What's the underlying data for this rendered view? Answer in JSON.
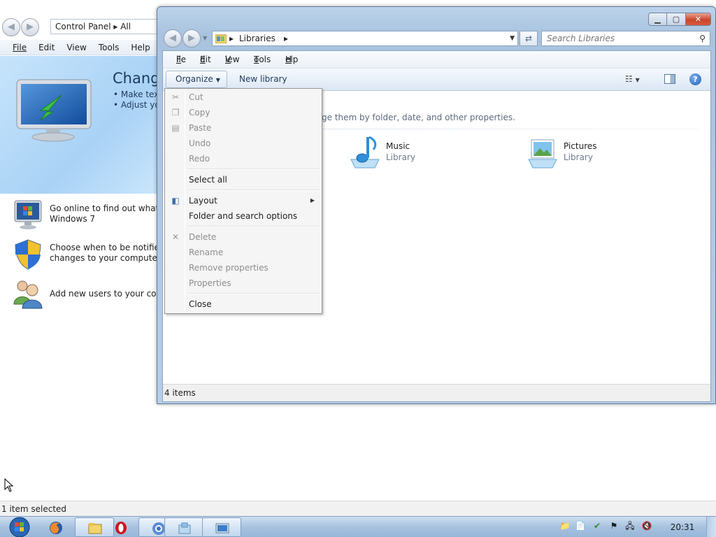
{
  "background_window": {
    "address": "Control Panel  ▸  All",
    "menu": [
      "File",
      "Edit",
      "View",
      "Tools",
      "Help"
    ],
    "banner_title": "Change",
    "banner_bullets": [
      "• Make text",
      "• Adjust you"
    ],
    "tasks": [
      {
        "line1": "Go online to find out what's n",
        "line2": "Windows 7",
        "icon": "windows-monitor-icon"
      },
      {
        "line1": "Choose when to be notified a",
        "line2": "changes to your computer",
        "icon": "uac-shield-icon"
      },
      {
        "line1": "Add new users to your comp",
        "line2": "",
        "icon": "users-icon"
      }
    ],
    "status": "1 item selected"
  },
  "window": {
    "address_crumb": "Libraries",
    "search_placeholder": "Search Libraries",
    "menu": [
      {
        "label": "File",
        "key": "F"
      },
      {
        "label": "Edit",
        "key": "E"
      },
      {
        "label": "View",
        "key": "V"
      },
      {
        "label": "Tools",
        "key": "T"
      },
      {
        "label": "Help",
        "key": "H"
      }
    ],
    "toolbar": {
      "organize": "Organize",
      "new_library": "New library"
    },
    "description": "ge them by folder, date, and other properties.",
    "libraries": [
      {
        "name": "Music",
        "sub": "Library",
        "icon": "music-library-icon"
      },
      {
        "name": "Pictures",
        "sub": "Library",
        "icon": "pictures-library-icon"
      }
    ],
    "status": "4 items"
  },
  "organize_menu": {
    "items": [
      {
        "label": "Cut",
        "enabled": false,
        "icon": "cut-icon"
      },
      {
        "label": "Copy",
        "enabled": false,
        "icon": "copy-icon"
      },
      {
        "label": "Paste",
        "enabled": false,
        "icon": "paste-icon"
      },
      {
        "label": "Undo",
        "enabled": false
      },
      {
        "label": "Redo",
        "enabled": false
      },
      {
        "label": "Select all",
        "enabled": true
      },
      {
        "label": "Layout",
        "enabled": true,
        "icon": "layout-icon",
        "submenu": true
      },
      {
        "label": "Folder and search options",
        "enabled": true
      },
      {
        "label": "Delete",
        "enabled": false,
        "icon": "delete-icon"
      },
      {
        "label": "Rename",
        "enabled": false
      },
      {
        "label": "Remove properties",
        "enabled": false
      },
      {
        "label": "Properties",
        "enabled": false
      },
      {
        "label": "Close",
        "enabled": true
      }
    ]
  },
  "taskbar": {
    "clock": "20:31",
    "apps": [
      "firefox-icon",
      "explorer-icon",
      "opera-icon",
      "chrome-icon",
      "libraries-icon",
      "control-panel-icon"
    ]
  },
  "colors": {
    "accent": "#1e395b",
    "window_frame": "#b6cde6",
    "banner": "#a9d2f5",
    "close_button": "#c9462c"
  }
}
